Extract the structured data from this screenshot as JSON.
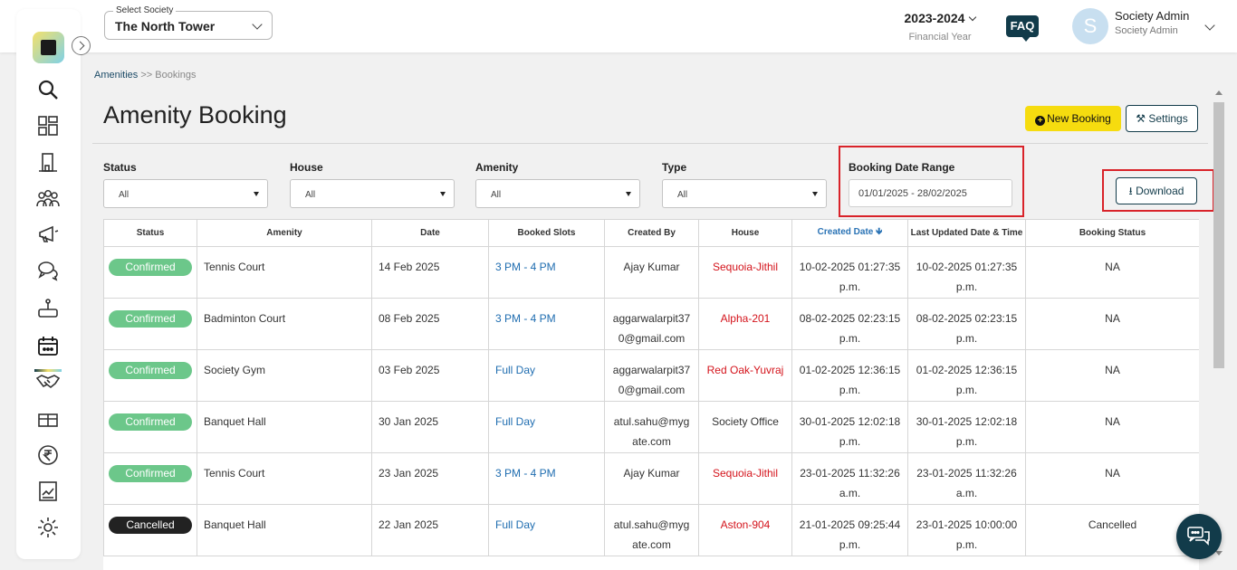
{
  "header": {
    "society_label": "Select Society",
    "society_value": "The North Tower",
    "financial_year": "2023-2024",
    "financial_year_label": "Financial Year",
    "faq": "FAQ",
    "avatar_initial": "S",
    "user_name": "Society Admin",
    "user_role": "Society Admin"
  },
  "sidebar": {
    "items": [
      "search-icon",
      "dashboard-icon",
      "building-icon",
      "members-icon",
      "announcement-icon",
      "chat-icon",
      "helpdesk-icon",
      "calendar-icon",
      "handshake-icon",
      "amenity-icon",
      "rupee-icon",
      "reports-icon",
      "settings-icon"
    ],
    "active": "calendar-icon"
  },
  "breadcrumb": {
    "root": "Amenities",
    "sep": " >> ",
    "current": "Bookings"
  },
  "page": {
    "title": "Amenity Booking",
    "new_booking": "New Booking",
    "settings": "Settings",
    "download": "Download"
  },
  "filters": {
    "status": {
      "label": "Status",
      "value": "All"
    },
    "house": {
      "label": "House",
      "value": "All"
    },
    "amenity": {
      "label": "Amenity",
      "value": "All"
    },
    "type": {
      "label": "Type",
      "value": "All"
    },
    "date_range": {
      "label": "Booking Date Range",
      "value": "01/01/2025 - 28/02/2025"
    }
  },
  "table": {
    "columns": [
      "Status",
      "Amenity",
      "Date",
      "Booked Slots",
      "Created By",
      "House",
      "Created Date",
      "Last Updated Date & Time",
      "Booking Status"
    ],
    "sorted_column": "Created Date",
    "rows": [
      {
        "status": "Confirmed",
        "amenity": "Tennis Court",
        "date": "14 Feb 2025",
        "slot": "3 PM - 4 PM",
        "created_by": "Ajay Kumar",
        "house": "Sequoia-Jithil",
        "created": "10-02-2025 01:27:35 p.m.",
        "updated": "10-02-2025 01:27:35 p.m.",
        "booking_status": "NA"
      },
      {
        "status": "Confirmed",
        "amenity": "Badminton Court",
        "date": "08 Feb 2025",
        "slot": "3 PM - 4 PM",
        "created_by": "aggarwalarpit370@gmail.com",
        "house": "Alpha-201",
        "created": "08-02-2025 02:23:15 p.m.",
        "updated": "08-02-2025 02:23:15 p.m.",
        "booking_status": "NA"
      },
      {
        "status": "Confirmed",
        "amenity": "Society Gym",
        "date": "03 Feb 2025",
        "slot": "Full Day",
        "created_by": "aggarwalarpit370@gmail.com",
        "house": "Red Oak-Yuvraj",
        "created": "01-02-2025 12:36:15 p.m.",
        "updated": "01-02-2025 12:36:15 p.m.",
        "booking_status": "NA"
      },
      {
        "status": "Confirmed",
        "amenity": "Banquet Hall",
        "date": "30 Jan 2025",
        "slot": "Full Day",
        "created_by": "atul.sahu@mygate.com",
        "house": "Society Office",
        "house_plain": true,
        "created": "30-01-2025 12:02:18 p.m.",
        "updated": "30-01-2025 12:02:18 p.m.",
        "booking_status": "NA"
      },
      {
        "status": "Confirmed",
        "amenity": "Tennis Court",
        "date": "23 Jan 2025",
        "slot": "3 PM - 4 PM",
        "created_by": "Ajay Kumar",
        "house": "Sequoia-Jithil",
        "created": "23-01-2025 11:32:26 a.m.",
        "updated": "23-01-2025 11:32:26 a.m.",
        "booking_status": "NA"
      },
      {
        "status": "Cancelled",
        "amenity": "Banquet Hall",
        "date": "22 Jan 2025",
        "slot": "Full Day",
        "created_by": "atul.sahu@mygate.com",
        "house": "Aston-904",
        "created": "21-01-2025 09:25:44 p.m.",
        "updated": "23-01-2025 10:00:00 p.m.",
        "booking_status": "Cancelled"
      }
    ]
  },
  "colors": {
    "primary": "#123b4a",
    "accent_yellow": "#f6dc0f",
    "confirmed": "#6cc78a",
    "cancelled": "#222222",
    "house_red": "#d4141c",
    "slot_blue": "#1f6db0",
    "highlight_red": "#d9232a"
  }
}
